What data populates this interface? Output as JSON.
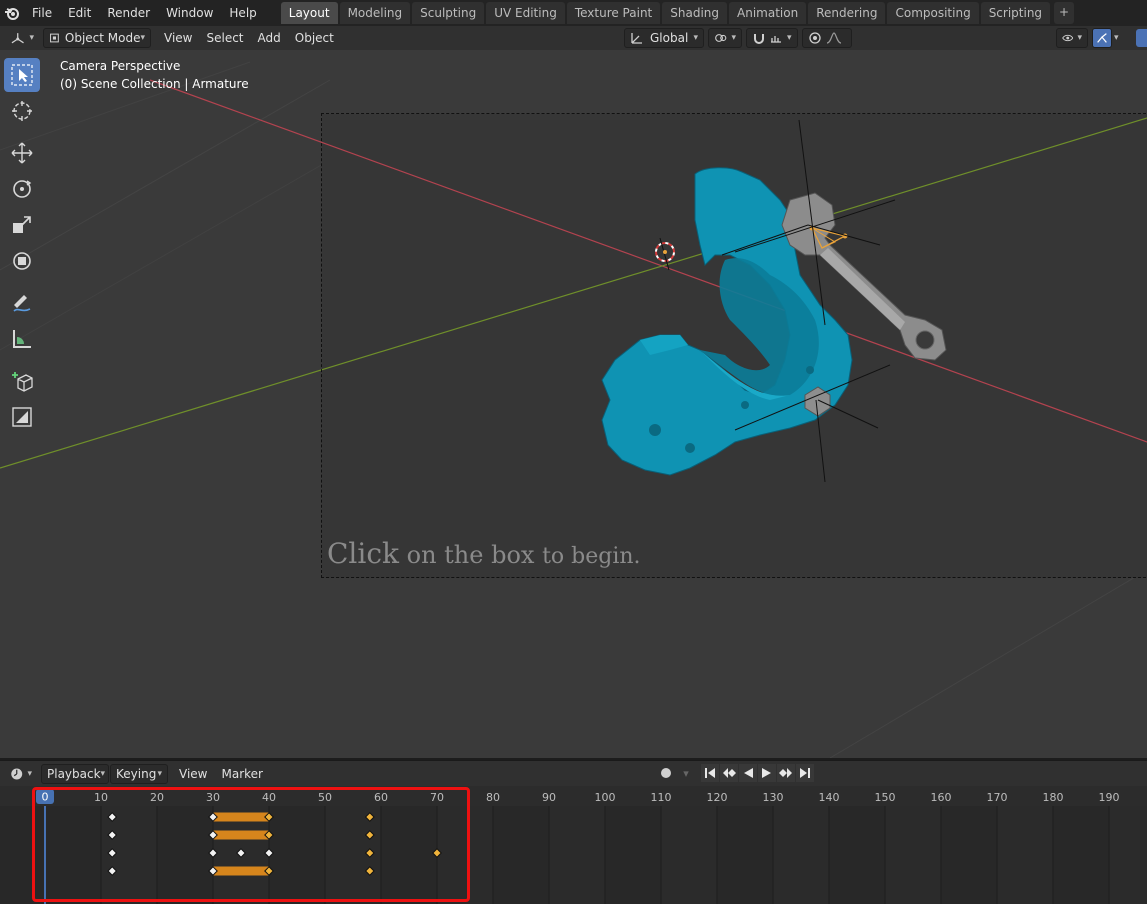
{
  "topbar": {
    "menus": [
      "File",
      "Edit",
      "Render",
      "Window",
      "Help"
    ],
    "workspaces": [
      "Layout",
      "Modeling",
      "Sculpting",
      "UV Editing",
      "Texture Paint",
      "Shading",
      "Animation",
      "Rendering",
      "Compositing",
      "Scripting"
    ],
    "active_workspace": "Layout",
    "add_tab": "+"
  },
  "viewport_header": {
    "mode": "Object Mode",
    "menus": [
      "View",
      "Select",
      "Add",
      "Object"
    ],
    "orientation": "Global"
  },
  "viewport": {
    "perspective_label": "Camera Perspective",
    "collection_label": "(0) Scene Collection | Armature",
    "start_text": {
      "part1": "Click",
      "part2": " on the box ",
      "part3": "to begin."
    },
    "colors": {
      "x_axis": "#b3434f",
      "y_axis": "#6f8f2a",
      "model": "#0f93b3",
      "selection": "#e8a23a"
    }
  },
  "tools": [
    {
      "name": "select-box-tool",
      "active": true
    },
    {
      "name": "cursor-tool",
      "active": false
    },
    {
      "name": "move-tool",
      "active": false
    },
    {
      "name": "rotate-tool",
      "active": false
    },
    {
      "name": "scale-tool",
      "active": false
    },
    {
      "name": "transform-tool",
      "active": false
    },
    {
      "name": "annotate-tool",
      "active": false
    },
    {
      "name": "measure-tool",
      "active": false
    },
    {
      "name": "add-cube-tool",
      "active": false
    },
    {
      "name": "shader-tool",
      "active": false
    }
  ],
  "timeline": {
    "menus": {
      "playback": "Playback",
      "keying": "Keying",
      "view": "View",
      "marker": "Marker"
    },
    "current_frame": "0",
    "frame_labels": [
      "10",
      "20",
      "30",
      "40",
      "50",
      "60",
      "70",
      "80",
      "90",
      "100",
      "110",
      "120",
      "130",
      "140",
      "150",
      "160",
      "170",
      "180",
      "190"
    ],
    "channels": [
      {
        "keys": [
          {
            "f": 12,
            "sel": false
          },
          {
            "f": 30,
            "sel": false
          },
          {
            "f": 40,
            "sel": true
          },
          {
            "f": 58,
            "sel": true
          }
        ],
        "hold": [
          30,
          40
        ]
      },
      {
        "keys": [
          {
            "f": 12,
            "sel": false
          },
          {
            "f": 30,
            "sel": false
          },
          {
            "f": 40,
            "sel": true
          },
          {
            "f": 58,
            "sel": true
          }
        ],
        "hold": [
          30,
          40
        ]
      },
      {
        "keys": [
          {
            "f": 12,
            "sel": false
          },
          {
            "f": 30,
            "sel": false
          },
          {
            "f": 35,
            "sel": false
          },
          {
            "f": 40,
            "sel": false
          },
          {
            "f": 58,
            "sel": true
          },
          {
            "f": 70,
            "sel": true
          }
        ],
        "hold": null
      },
      {
        "keys": [
          {
            "f": 12,
            "sel": false
          },
          {
            "f": 30,
            "sel": false
          },
          {
            "f": 40,
            "sel": true
          },
          {
            "f": 58,
            "sel": true
          }
        ],
        "hold": [
          30,
          40
        ]
      }
    ]
  }
}
